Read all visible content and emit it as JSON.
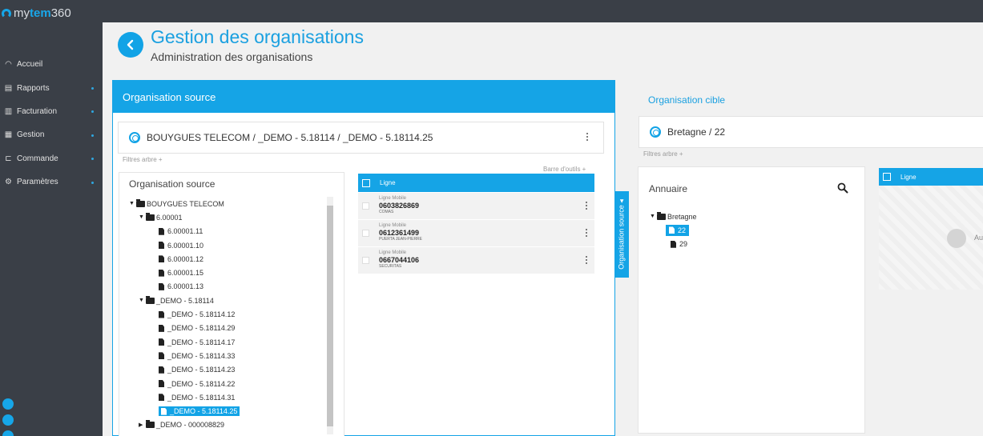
{
  "app": {
    "logo_prefix": "my",
    "logo_bold": "tem",
    "logo_suffix": "360"
  },
  "sidebar": {
    "items": [
      {
        "label": "Accueil",
        "icon": "gauge-icon",
        "has_dot": false
      },
      {
        "label": "Rapports",
        "icon": "report-icon",
        "has_dot": true
      },
      {
        "label": "Facturation",
        "icon": "bank-icon",
        "has_dot": true
      },
      {
        "label": "Gestion",
        "icon": "sitemap-icon",
        "has_dot": true
      },
      {
        "label": "Commande",
        "icon": "cart-icon",
        "has_dot": true
      },
      {
        "label": "Paramètres",
        "icon": "gear-icon",
        "has_dot": true
      }
    ]
  },
  "header": {
    "title": "Gestion des organisations",
    "subtitle": "Administration des organisations"
  },
  "source": {
    "panel_title": "Organisation source",
    "selected_path": "BOUYGUES TELECOM / _DEMO - 5.18114 / _DEMO - 5.18114.25",
    "filtres": "Filtres arbre +",
    "barre": "Barre d'outils +",
    "tree_title": "Organisation source",
    "tree": [
      {
        "label": "BOUYGUES TELECOM",
        "level": 0,
        "type": "folder",
        "open": true
      },
      {
        "label": "6.00001",
        "level": 1,
        "type": "folder",
        "open": true
      },
      {
        "label": "6.00001.11",
        "level": 2,
        "type": "file"
      },
      {
        "label": "6.00001.10",
        "level": 2,
        "type": "file"
      },
      {
        "label": "6.00001.12",
        "level": 2,
        "type": "file"
      },
      {
        "label": "6.00001.15",
        "level": 2,
        "type": "file"
      },
      {
        "label": "6.00001.13",
        "level": 2,
        "type": "file"
      },
      {
        "label": "_DEMO - 5.18114",
        "level": 1,
        "type": "folder",
        "open": true
      },
      {
        "label": "_DEMO - 5.18114.12",
        "level": 2,
        "type": "file"
      },
      {
        "label": "_DEMO - 5.18114.29",
        "level": 2,
        "type": "file"
      },
      {
        "label": "_DEMO - 5.18114.17",
        "level": 2,
        "type": "file"
      },
      {
        "label": "_DEMO - 5.18114.33",
        "level": 2,
        "type": "file"
      },
      {
        "label": "_DEMO - 5.18114.23",
        "level": 2,
        "type": "file"
      },
      {
        "label": "_DEMO - 5.18114.22",
        "level": 2,
        "type": "file"
      },
      {
        "label": "_DEMO - 5.18114.31",
        "level": 2,
        "type": "file"
      },
      {
        "label": "_DEMO - 5.18114.25",
        "level": 2,
        "type": "file",
        "selected": true
      },
      {
        "label": "_DEMO - 000008829",
        "level": 1,
        "type": "folder-closed"
      }
    ],
    "lines_header": "Ligne",
    "lines": [
      {
        "type": "Ligne Mobile",
        "number": "0603826869",
        "owner": "COMAS"
      },
      {
        "type": "Ligne Mobile",
        "number": "0612361499",
        "owner": "PUERTA JEAN-PIERRE"
      },
      {
        "type": "Ligne Mobile",
        "number": "0667044106",
        "owner": "SECURITAS"
      }
    ]
  },
  "side_tab": {
    "label": "Organisation source ◂"
  },
  "target": {
    "title": "Organisation cible",
    "selected_path": "Bretagne / 22",
    "filtres": "Filtres arbre +",
    "annuaire": "Annuaire",
    "tree": [
      {
        "label": "Bretagne",
        "type": "folder"
      },
      {
        "label": "22",
        "type": "file",
        "selected": true
      },
      {
        "label": "29",
        "type": "file"
      }
    ],
    "lines_header": "Ligne",
    "empty_text": "Au"
  }
}
